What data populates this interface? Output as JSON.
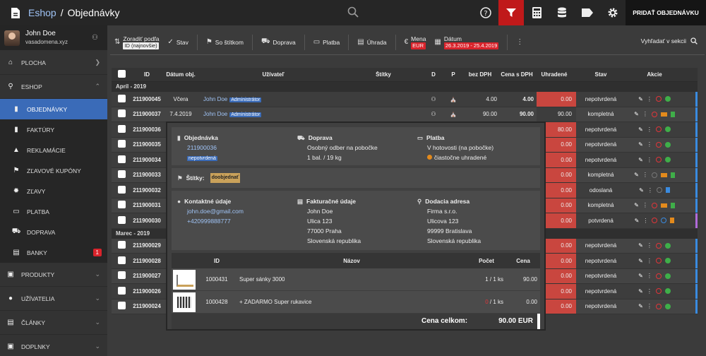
{
  "header": {
    "app": "Eshop",
    "separator": "/",
    "page": "Objednávky",
    "add_button": "PRIDAŤ OBJEDNÁVKU"
  },
  "user": {
    "name": "John Doe",
    "domain": "vasadomena.xyz"
  },
  "sidebar": {
    "items": [
      {
        "label": "PLOCHA",
        "icon": "home-icon"
      },
      {
        "label": "ESHOP",
        "icon": "cart-icon"
      },
      {
        "label": "OBJEDNÁVKY",
        "icon": "document-icon"
      },
      {
        "label": "FAKTÚRY",
        "icon": "invoice-icon"
      },
      {
        "label": "REKLAMÁCIE",
        "icon": "warning-icon"
      },
      {
        "label": "ZĽAVOVÉ KUPÓNY",
        "icon": "tag-icon"
      },
      {
        "label": "ZĽAVY",
        "icon": "badge-icon"
      },
      {
        "label": "PLATBA",
        "icon": "wallet-icon"
      },
      {
        "label": "DOPRAVA",
        "icon": "truck-icon"
      },
      {
        "label": "BANKY",
        "icon": "bank-icon",
        "badge": "1"
      },
      {
        "label": "PRODUKTY",
        "icon": "box-icon"
      },
      {
        "label": "UŽÍVATELIA",
        "icon": "user-icon"
      },
      {
        "label": "ČLÁNKY",
        "icon": "article-icon"
      },
      {
        "label": "DOPLNKY",
        "icon": "plugin-icon"
      }
    ]
  },
  "toolbar": {
    "sort_label": "Zoradiť podľa",
    "sort_value": "ID (najnovšie)",
    "status": "Stav",
    "labeled": "So štítkom",
    "shipping": "Doprava",
    "payment": "Platba",
    "paid": "Úhrada",
    "currency_label": "Mena",
    "currency_value": "EUR",
    "date_label": "Dátum",
    "date_value": "26.3.2019 - 25.4.2019",
    "search_section": "Vyhľadať v sekcii"
  },
  "table": {
    "headers": {
      "id": "ID",
      "date": "Dátum obj.",
      "user": "Užívateľ",
      "labels": "Štítky",
      "d": "D",
      "p": "P",
      "net": "bez DPH",
      "gross": "Cena s DPH",
      "paid": "Uhradené",
      "status": "Stav",
      "actions": "Akcie"
    },
    "group_april": "Apríl - 2019",
    "group_march": "Marec - 2019",
    "rows": [
      {
        "id": "211900045",
        "date": "Včera",
        "user": "John Doe",
        "role": "Administrátor",
        "net": "4.00",
        "gross": "4.00",
        "paid": "0.00",
        "status": "nepotvrdená"
      },
      {
        "id": "211900037",
        "date": "7.4.2019",
        "user": "John Doe",
        "role": "Administrátor",
        "net": "90.00",
        "gross": "90.00",
        "paid": "90.00",
        "status": "kompletná"
      },
      {
        "id": "211900036",
        "paid": "80.00",
        "status": "nepotvrdená"
      },
      {
        "id": "211900035",
        "paid": "0.00",
        "status": "nepotvrdená"
      },
      {
        "id": "211900034",
        "paid": "0.00",
        "status": "nepotvrdená"
      },
      {
        "id": "211900033",
        "paid": "0.00",
        "status": "kompletná"
      },
      {
        "id": "211900032",
        "paid": "0.00",
        "status": "odoslaná"
      },
      {
        "id": "211900031",
        "paid": "0.00",
        "status": "kompletná"
      },
      {
        "id": "211900030",
        "paid": "0.00",
        "status": "potvrdená"
      },
      {
        "id": "211900029",
        "paid": "0.00",
        "status": "nepotvrdená"
      },
      {
        "id": "211900028",
        "paid": "0.00",
        "status": "nepotvrdená"
      },
      {
        "id": "211900027",
        "paid": "0.00",
        "status": "nepotvrdená"
      },
      {
        "id": "211900026",
        "paid": "0.00",
        "status": "nepotvrdená"
      },
      {
        "id": "211900024",
        "paid": "0.00",
        "status": "nepotvrdená"
      }
    ]
  },
  "popup": {
    "order_title": "Objednávka",
    "order_id": "211900036",
    "order_state": "nepotvrdená",
    "shipping_title": "Doprava",
    "shipping_method": "Osobný odber na pobočke",
    "shipping_weight": "1 bal. / 19 kg",
    "payment_title": "Platba",
    "payment_method": "V hotovosti (na pobočke)",
    "payment_state": "čiastočne uhradené",
    "labels_title": "Štítky:",
    "labels_value": "doobjednať",
    "contact_title": "Kontaktné údaje",
    "email": "john.doe@gmail.com",
    "phone": "+420999888777",
    "billing_title": "Fakturačné údaje",
    "billing": [
      "John Doe",
      "Ulica 123",
      "77000 Praha",
      "Slovenská republika"
    ],
    "delivery_title": "Dodacia adresa",
    "delivery": [
      "Firma s.r.o.",
      "Ulicova 123",
      "99999 Bratislava",
      "Slovenská republika"
    ],
    "items_headers": {
      "id": "ID",
      "name": "Názov",
      "qty": "Počet",
      "price": "Cena"
    },
    "items": [
      {
        "id": "1000431",
        "name": "Super sánky 3000",
        "qty_a": "1",
        "qty_b": "1 ks",
        "price": "90.00"
      },
      {
        "id": "1000428",
        "name": "+ ZADARMO Super rukavice",
        "qty_a": "0",
        "qty_b": "1 ks",
        "price": "0.00"
      }
    ],
    "total_label": "Cena celkom:",
    "total_value": "90.00 EUR"
  },
  "colors": {
    "accent_red": "#c0191a",
    "active_blue": "#3a6bb8",
    "paid_red": "#c9463f"
  }
}
